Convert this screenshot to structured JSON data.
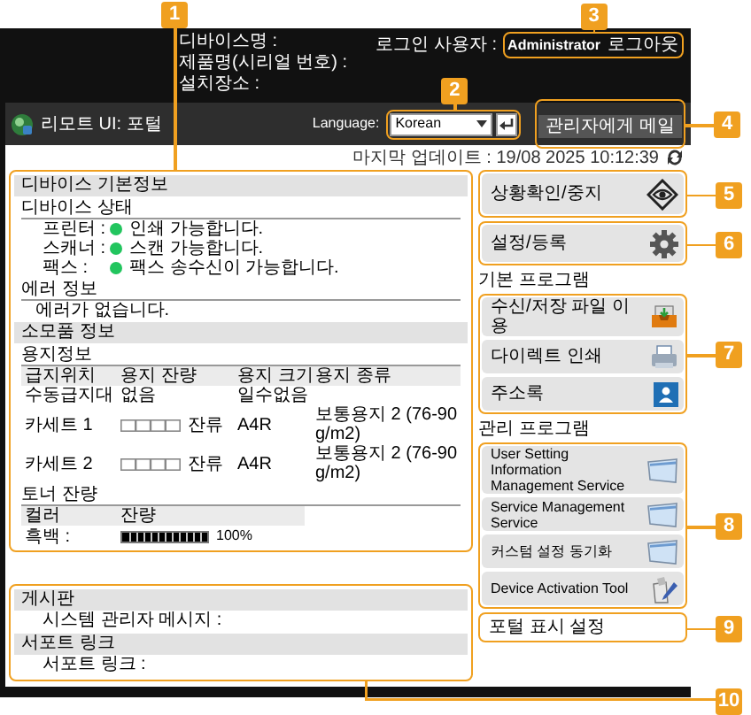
{
  "callouts": [
    "1",
    "2",
    "3",
    "4",
    "5",
    "6",
    "7",
    "8",
    "9",
    "10"
  ],
  "header": {
    "device_fields": [
      "디바이스명 :",
      "제품명(시리얼 번호) :",
      "설치장소 :"
    ],
    "login_label": "로그인 사용자 :",
    "user": "Administrator",
    "logout": "로그아웃"
  },
  "title_bar": {
    "title": "리모트 UI: 포털",
    "language_label": "Language:",
    "language_value": "Korean",
    "mail_button": "관리자에게 메일"
  },
  "last_update": "마지막 업데이트 : 19/08 2025 10:12:39",
  "device_info": {
    "title": "디바이스 기본정보",
    "status_heading": "디바이스 상태",
    "status": [
      {
        "label": "프린터 :",
        "text": "인쇄 가능합니다.",
        "color": "#22c55e"
      },
      {
        "label": "스캐너 :",
        "text": "스캔 가능합니다.",
        "color": "#22c55e"
      },
      {
        "label": "팩스 :",
        "text": "팩스 송수신이 가능합니다.",
        "color": "#22c55e"
      }
    ],
    "error_heading": "에러 정보",
    "error_text": "에러가 없습니다."
  },
  "consumables": {
    "title": "소모품 정보",
    "paper_heading": "용지정보",
    "paper_columns": [
      "급지위치",
      "용지 잔량",
      "용지 크기",
      "용지 종류"
    ],
    "paper_rows": [
      {
        "source": "수동급지대",
        "kind": "text",
        "remaining": "없음",
        "size": "일수없음",
        "type": ""
      },
      {
        "source": "카세트 1",
        "kind": "gauge",
        "remaining": "잔류",
        "size": "A4R",
        "type": "보통용지 2 (76-90 g/m2)"
      },
      {
        "source": "카세트 2",
        "kind": "gauge",
        "remaining": "잔류",
        "size": "A4R",
        "type": "보통용지 2 (76-90 g/m2)"
      }
    ],
    "toner_heading": "토너 잔량",
    "toner_columns": [
      "컬러",
      "잔량"
    ],
    "toner_rows": [
      {
        "color_name": "흑백 :",
        "level": 1,
        "reading": "100%"
      }
    ]
  },
  "bulletin": {
    "title": "게시판",
    "message_label": "시스템 관리자 메시지 :",
    "support_title": "서포트 링크",
    "support_label": "서포트 링크 :"
  },
  "status_button": "상황확인/중지",
  "settings_button": "설정/등록",
  "basic_programs": {
    "heading": "기본 프로그램",
    "items": [
      {
        "label": "수신/저장 파일 이용",
        "kind": "tray"
      },
      {
        "label": "다이렉트 인쇄",
        "kind": "printer"
      },
      {
        "label": "주소록",
        "kind": "contacts"
      }
    ]
  },
  "admin_programs": {
    "heading": "관리 프로그램",
    "items": [
      {
        "label": "User Setting Information Management Service",
        "kind": "window"
      },
      {
        "label": "Service Management Service",
        "kind": "window"
      },
      {
        "label": "커스텀 설정 동기화",
        "kind": "window"
      },
      {
        "label": "Device Activation Tool",
        "kind": "tool"
      }
    ]
  },
  "portal_settings": "포털 표시 설정"
}
